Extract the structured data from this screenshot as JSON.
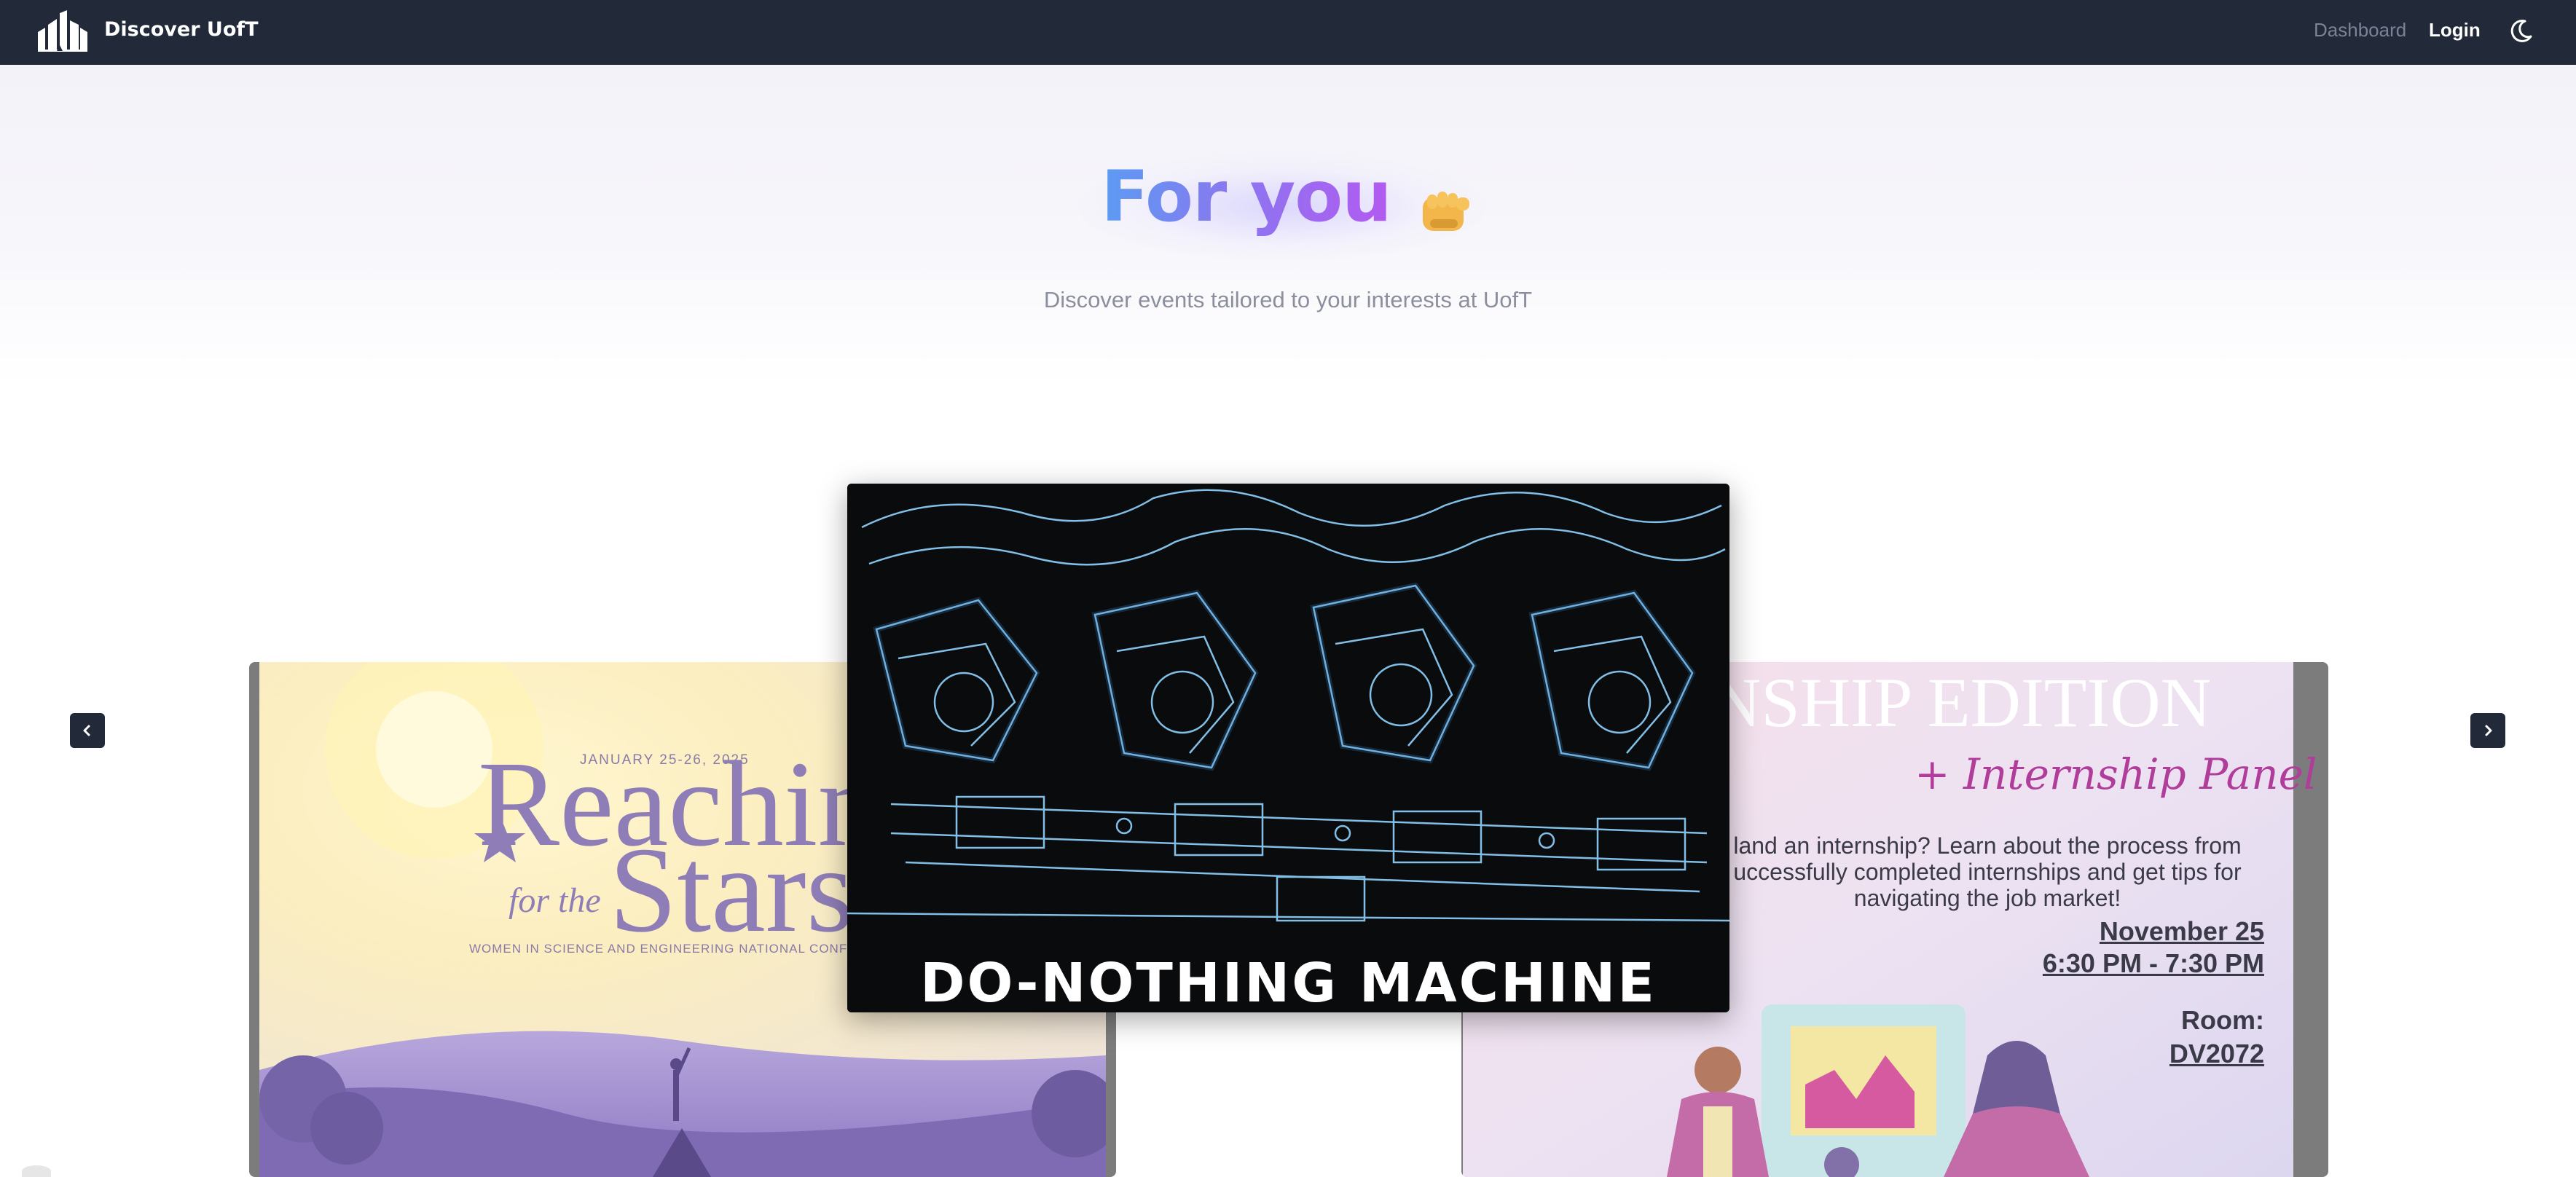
{
  "navbar": {
    "brand": "Discover UofT",
    "links": [
      {
        "label": "Dashboard"
      },
      {
        "label": "Login"
      }
    ],
    "theme_icon": "moon-icon"
  },
  "hero": {
    "title": "For you",
    "title_icon": "fist-emoji-icon",
    "subtitle": "Discover events tailored to your interests at UofT"
  },
  "carousel": {
    "prev_icon": "chevron-left-icon",
    "next_icon": "chevron-right-icon",
    "cards": {
      "left": {
        "date": "JANUARY 25-26, 2025",
        "line1": "Reachin",
        "line2": "for the",
        "line3": "Stars",
        "conference": "WOMEN IN SCIENCE AND ENGINEERING NATIONAL CONFERENCE"
      },
      "center": {
        "title": "DO-NOTHING MACHINE"
      },
      "right": {
        "edition": "NSHIP EDITION",
        "panel": "+ Internship Panel",
        "body": "land an internship? Learn about the process from uccessfully completed internships and get tips for navigating the job market!",
        "date": "November 25",
        "time": "6:30 PM - 7:30 PM",
        "room_label": "Room:",
        "room": "DV2072"
      }
    }
  },
  "colors": {
    "navbar_bg": "#222938",
    "title_gradient_start": "#5b9cf2",
    "title_gradient_end": "#b35af0",
    "subtitle": "#8b8e9c",
    "arrow_bg": "#222938"
  }
}
